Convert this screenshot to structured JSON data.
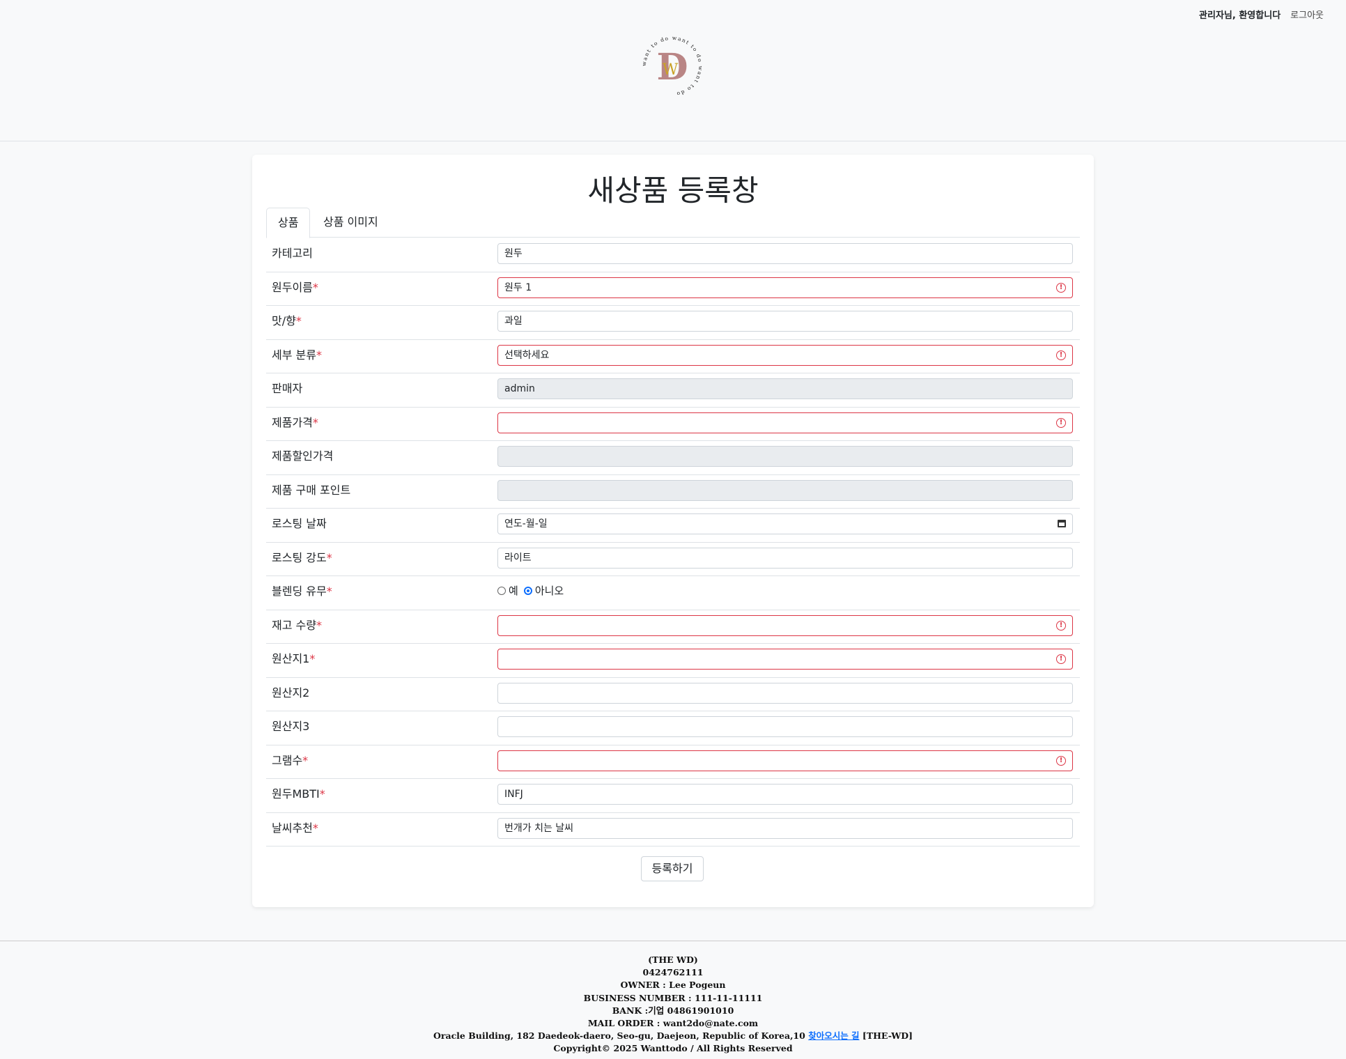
{
  "topnav": {
    "welcome": "관리자님, 환영합니다",
    "logout": "로그아웃"
  },
  "logo": {
    "ring_text": "want to do want to do want to do",
    "initials": "WD",
    "color_main": "#b98585",
    "color_accent": "#c9a227"
  },
  "page": {
    "title": "새상품 등록창"
  },
  "tabs": [
    {
      "label": "상품"
    },
    {
      "label": "상품 이미지"
    }
  ],
  "form": {
    "category": {
      "label": "카테고리",
      "value": "원두"
    },
    "bean_name": {
      "label": "원두이름",
      "value": "원두 1"
    },
    "flavor": {
      "label": "맛/향",
      "value": "과일"
    },
    "subcategory": {
      "label": "세부 분류",
      "value": "선택하세요"
    },
    "seller": {
      "label": "판매자",
      "value": "admin"
    },
    "price": {
      "label": "제품가격",
      "value": ""
    },
    "discount_price": {
      "label": "제품할인가격",
      "value": ""
    },
    "points": {
      "label": "제품 구매 포인트",
      "value": ""
    },
    "roasting_date": {
      "label": "로스팅 날짜",
      "value": "연도-월-일"
    },
    "roasting_level": {
      "label": "로스팅 강도",
      "value": "라이트"
    },
    "blending": {
      "label": "블렌딩 유무",
      "option_yes": "예",
      "option_no": "아니오",
      "selected": "아니오"
    },
    "stock": {
      "label": "재고 수량",
      "value": ""
    },
    "origin1": {
      "label": "원산지1",
      "value": ""
    },
    "origin2": {
      "label": "원산지2",
      "value": ""
    },
    "origin3": {
      "label": "원산지3",
      "value": ""
    },
    "grams": {
      "label": "그램수",
      "value": ""
    },
    "mbti": {
      "label": "원두MBTI",
      "value": "INFJ"
    },
    "weather": {
      "label": "날씨추천",
      "value": "번개가 치는 날씨"
    },
    "required_mark": "*",
    "submit_label": "등록하기"
  },
  "footer": {
    "company": "(THE WD)",
    "phone": "0424762111",
    "owner": "OWNER : Lee Pogeun",
    "business_number": "BUSINESS NUMBER : 111-11-11111",
    "bank": "BANK :기업 04861901010",
    "mail": "MAIL ORDER : want2do@nate.com",
    "address": "Oracle Building, 182 Daedeok-daero, Seo-gu, Daejeon, Republic of Korea,10",
    "directions_link": "찾아오시는 길",
    "address_suffix": "[THE-WD]",
    "copyright": "Copyright© 2025 Wanttodo / All Rights Reserved"
  }
}
